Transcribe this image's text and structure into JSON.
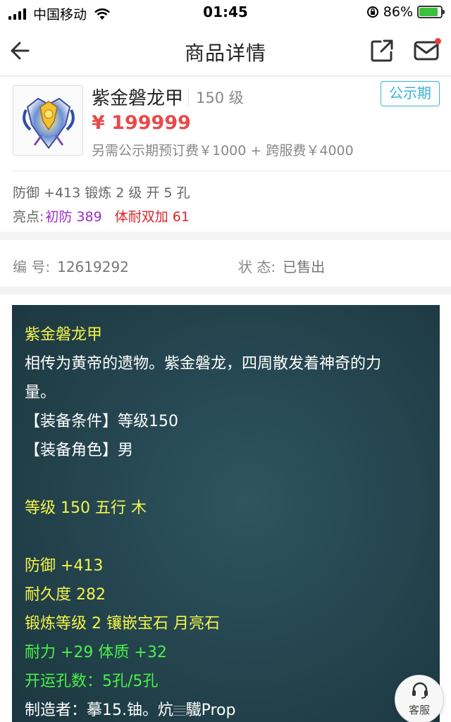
{
  "status_bar": {
    "carrier": "中国移动",
    "time": "01:45",
    "battery_percent": "86%",
    "icons": [
      "signal-icon",
      "wifi-icon",
      "lock-rotation-icon",
      "battery-icon"
    ]
  },
  "nav": {
    "title": "商品详情",
    "icons": [
      "back-arrow-icon",
      "share-icon",
      "mail-icon"
    ]
  },
  "product": {
    "name": "紫金磐龙甲",
    "level": "150 级",
    "badge": "公示期",
    "price": "¥ 199999",
    "fee_note": "另需公示期预订费￥1000 + 跨服费￥4000",
    "attributes": "防御 +413 锻炼 2 级 开 5 孔",
    "highlight_label": "亮点:",
    "highlight_1": "初防 389",
    "highlight_2": "体耐双加 61"
  },
  "info": {
    "id_label": "编 号:",
    "id_value": "12619292",
    "status_label": "状 态:",
    "status_value": "已售出"
  },
  "description": {
    "title": "紫金磐龙甲",
    "lore_1": "相传为黄帝的遗物。紫金磐龙，四周散发着神奇的力",
    "lore_2": "量。",
    "condition": "【装备条件】等级150",
    "role": "【装备角色】男",
    "level_element": "等级 150 五行 木",
    "defense": "防御 +413",
    "durability": "耐久度 282",
    "forge": "锻炼等级 2 镶嵌宝石 月亮石",
    "stats": "耐力 +29 体质 +32",
    "holes": "开运孔数：5孔/5孔",
    "maker": "制造者：摹15.铀。炕𝄙驖Prop"
  },
  "customer_service": {
    "label": "客服"
  },
  "colors": {
    "price_red": "#e84a4a",
    "badge_blue": "#3bb3d6",
    "highlight_purple": "#9a2ec9",
    "highlight_red": "#d9262c",
    "desc_yellow": "#f5f54a",
    "desc_green": "#4af04a",
    "panel_bg": "#254650"
  }
}
